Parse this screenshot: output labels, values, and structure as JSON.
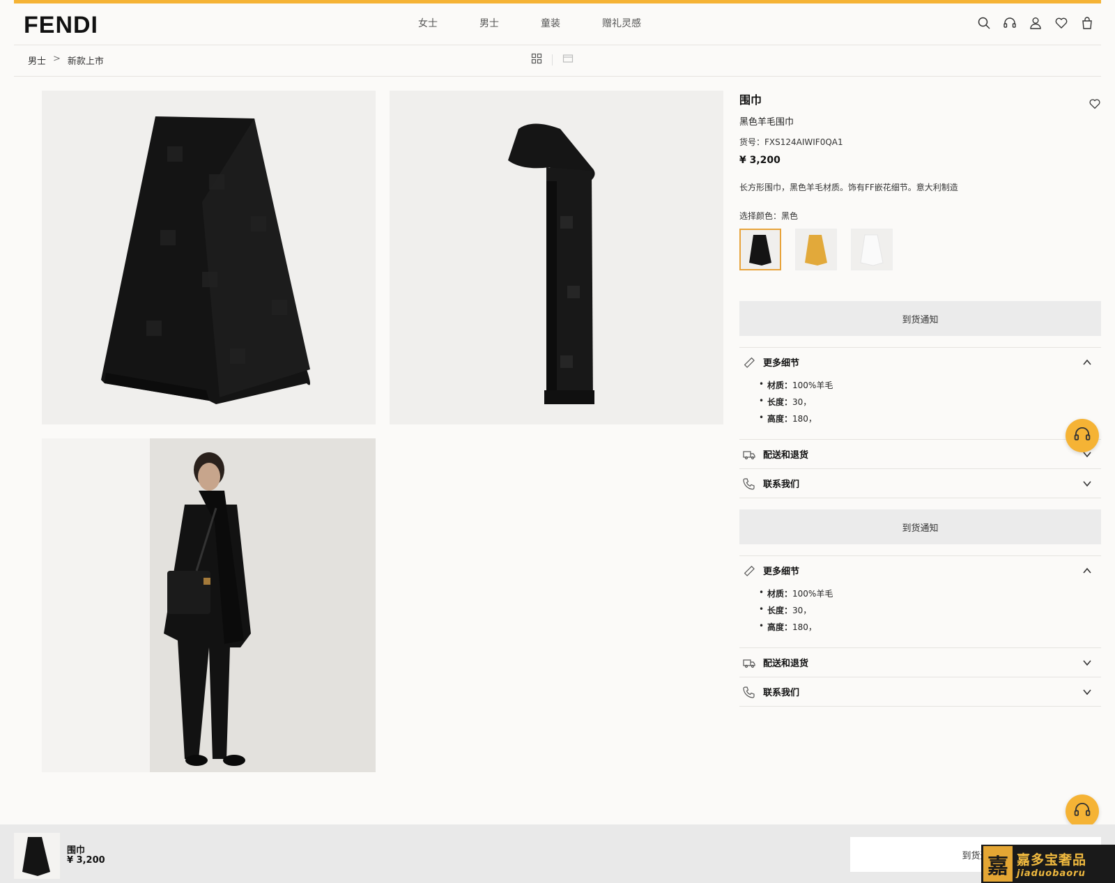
{
  "brand": {
    "logo": "FENDI",
    "accent": "#f5b335"
  },
  "nav": {
    "items": [
      "女士",
      "男士",
      "童装",
      "赠礼灵感"
    ]
  },
  "header_icons": [
    "search-icon",
    "headset-icon",
    "user-icon",
    "heart-icon",
    "bag-icon"
  ],
  "breadcrumb": {
    "items": [
      "男士",
      "新款上市"
    ],
    "separator": ">"
  },
  "view_toggle": [
    "grid-view-icon",
    "single-view-icon"
  ],
  "product": {
    "title": "围巾",
    "subtitle": "黑色羊毛围巾",
    "sku": "货号：FXS124AIWIF0QA1",
    "price": "¥ 3,200",
    "description": "长方形围巾，黑色羊毛材质。饰有FF嵌花细节。意大利制造",
    "color_label": "选择颜色：黑色",
    "colors": [
      {
        "name": "black",
        "hex": "#141414",
        "selected": true
      },
      {
        "name": "yellow",
        "hex": "#e2a93a",
        "selected": false
      },
      {
        "name": "white",
        "hex": "#f4f4f4",
        "selected": false
      }
    ]
  },
  "notify_label": "到货通知",
  "details": {
    "more_title": "更多细节",
    "specs": [
      {
        "key": "材质：",
        "value": "100%羊毛"
      },
      {
        "key": "长度：",
        "value": "30，"
      },
      {
        "key": "高度：",
        "value": "180，"
      }
    ],
    "shipping_title": "配送和退货",
    "contact_title": "联系我们"
  },
  "sticky": {
    "title": "围巾",
    "price": "¥ 3,200",
    "button": "到货通"
  },
  "watermark": {
    "logo": "嘉",
    "cn": "嘉多宝奢品",
    "en": "jiaduobaoru"
  }
}
